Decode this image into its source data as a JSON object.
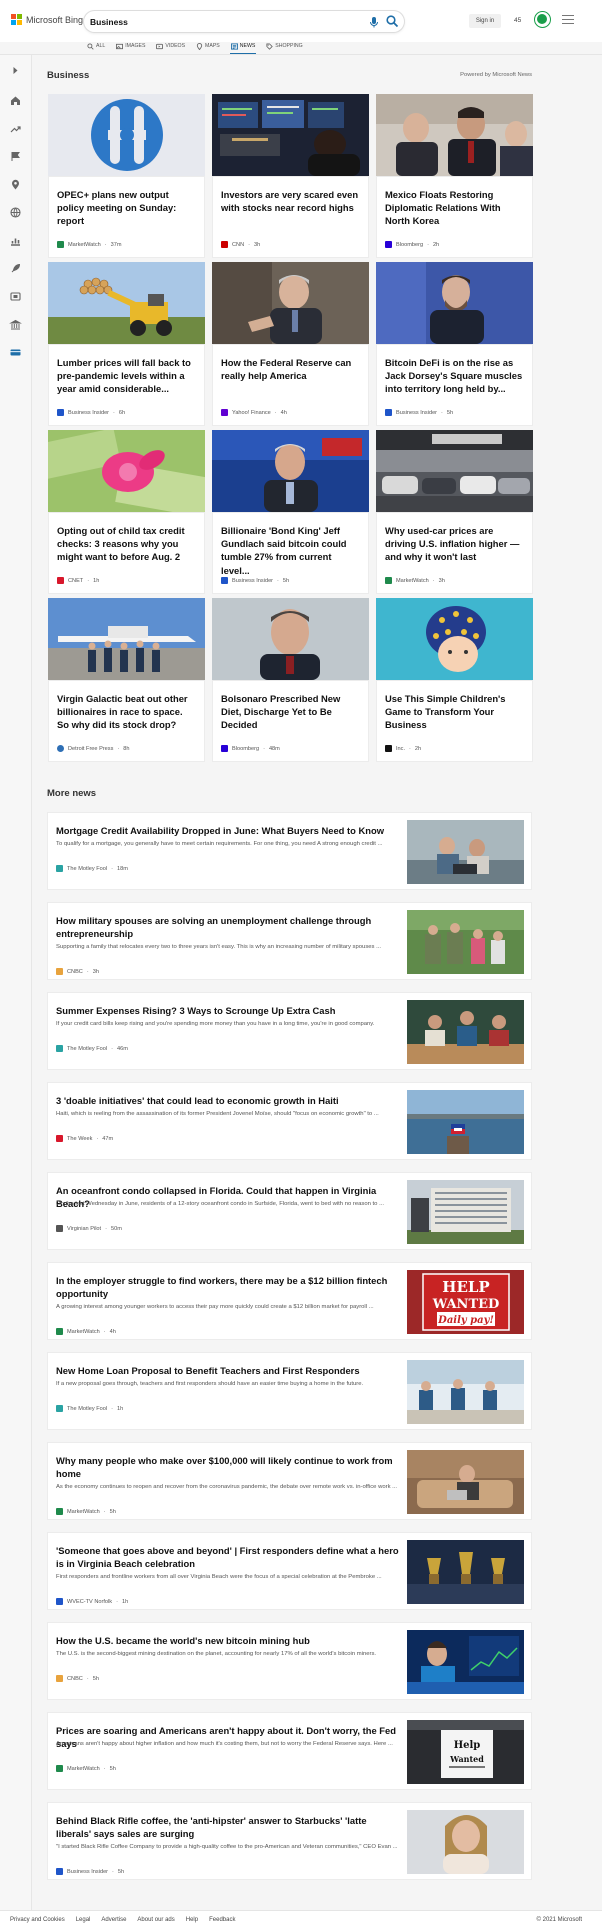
{
  "header": {
    "logo_text": "Microsoft Bing",
    "search_value": "Business",
    "sign_in": "Sign in",
    "points": "45"
  },
  "nav": [
    {
      "label": "ALL",
      "icon": "search-icon"
    },
    {
      "label": "IMAGES",
      "icon": "image-icon"
    },
    {
      "label": "VIDEOS",
      "icon": "video-icon"
    },
    {
      "label": "MAPS",
      "icon": "map-pin-icon"
    },
    {
      "label": "NEWS",
      "icon": "news-icon",
      "active": true
    },
    {
      "label": "SHOPPING",
      "icon": "tag-icon"
    }
  ],
  "section": {
    "title": "Business",
    "powered": "Powered by Microsoft News"
  },
  "top_stories": [
    {
      "title": "OPEC+ plans new output policy meeting on Sunday: report",
      "source": "MarketWatch",
      "time": "37m",
      "brand_color": "#1f8a4c"
    },
    {
      "title": "Investors are very scared even with stocks near record highs",
      "source": "CNN",
      "time": "3h",
      "brand_color": "#cc0000"
    },
    {
      "title": "Mexico Floats Restoring Diplomatic Relations With North Korea",
      "source": "Bloomberg",
      "time": "2h",
      "brand_color": "#2800d7"
    },
    {
      "title": "Lumber prices will fall back to pre-pandemic levels within a year amid considerable...",
      "source": "Business Insider",
      "time": "6h",
      "brand_color": "#1f55c9"
    },
    {
      "title": "How the Federal Reserve can really help America",
      "source": "Yahoo! Finance",
      "time": "4h",
      "brand_color": "#6001d2"
    },
    {
      "title": "Bitcoin DeFi is on the rise as Jack Dorsey's Square muscles into territory long held by...",
      "source": "Business Insider",
      "time": "5h",
      "brand_color": "#1f55c9"
    },
    {
      "title": "Opting out of child tax credit checks: 3 reasons why you might want to before Aug. 2",
      "source": "CNET",
      "time": "1h",
      "brand_color": "#d8172b"
    },
    {
      "title": "Billionaire 'Bond King' Jeff Gundlach said bitcoin could tumble 27% from current level...",
      "source": "Business Insider",
      "time": "5h",
      "brand_color": "#1f55c9"
    },
    {
      "title": "Why used-car prices are driving U.S. inflation higher — and why it won't last",
      "source": "MarketWatch",
      "time": "3h",
      "brand_color": "#1f8a4c"
    },
    {
      "title": "Virgin Galactic beat out other billionaires in race to space. So why did its stock drop?",
      "source": "Detroit Free Press",
      "time": "8h",
      "brand_color": "#2e6fb5"
    },
    {
      "title": "Bolsonaro Prescribed New Diet, Discharge Yet to Be Decided",
      "source": "Bloomberg",
      "time": "48m",
      "brand_color": "#2800d7"
    },
    {
      "title": "Use This Simple Children's Game to Transform Your Business",
      "source": "Inc.",
      "time": "2h",
      "brand_color": "#111111"
    }
  ],
  "more_news_title": "More news",
  "more_news": [
    {
      "title": "Mortgage Credit Availability Dropped in June: What Buyers Need to Know",
      "snippet": "To qualify for a mortgage, you generally have to meet certain requirements. For one thing, you need A strong enough credit ...",
      "source": "The Motley Fool",
      "time": "18m",
      "brand_color": "#2aa3a3"
    },
    {
      "title": "How military spouses are solving an unemployment challenge through entrepreneurship",
      "snippet": "Supporting a family that relocates every two to three years isn't easy. This is why an increasing number of military spouses ...",
      "source": "CNBC",
      "time": "3h",
      "brand_color": "#e8a33d"
    },
    {
      "title": "Summer Expenses Rising? 3 Ways to Scrounge Up Extra Cash",
      "snippet": "If your credit card bills keep rising and you're spending more money than you have in a long time, you're in good company.",
      "source": "The Motley Fool",
      "time": "46m",
      "brand_color": "#2aa3a3"
    },
    {
      "title": "3 'doable initiatives' that could lead to economic growth in Haiti",
      "snippet": "Haiti, which is reeling from the assassination of its former President Jovenel Moïse, should \"focus on economic growth\" to ...",
      "source": "The Week",
      "time": "47m",
      "brand_color": "#d8172b"
    },
    {
      "title": "An oceanfront condo collapsed in Florida. Could that happen in Virginia Beach?",
      "snippet": "On the last Wednesday in June, residents of a 12-story oceanfront condo in Surfside, Florida, went to bed with no reason to ...",
      "source": "Virginian Pilot",
      "time": "50m",
      "brand_color": "#555555"
    },
    {
      "title": "In the employer struggle to find workers, there may be a $12 billion fintech opportunity",
      "snippet": "A growing interest among younger workers to access their pay more quickly could create a $12 billion market for payroll ...",
      "source": "MarketWatch",
      "time": "4h",
      "brand_color": "#1f8a4c"
    },
    {
      "title": "New Home Loan Proposal to Benefit Teachers and First Responders",
      "snippet": "If a new proposal goes through, teachers and first responders should have an easier time buying a home in the future.",
      "source": "The Motley Fool",
      "time": "1h",
      "brand_color": "#2aa3a3"
    },
    {
      "title": "Why many people who make over $100,000 will likely continue to work from home",
      "snippet": "As the economy continues to reopen and recover from the coronavirus pandemic, the debate over remote work vs. in-office work ...",
      "source": "MarketWatch",
      "time": "5h",
      "brand_color": "#1f8a4c"
    },
    {
      "title": "'Someone that goes above and beyond' | First responders define what a hero is in Virginia Beach celebration",
      "snippet": "First responders and frontline workers from all over Virginia Beach were the focus of a special celebration at the Pembroke ...",
      "source": "WVEC-TV Norfolk",
      "time": "1h",
      "brand_color": "#1f55c9"
    },
    {
      "title": "How the U.S. became the world's new bitcoin mining hub",
      "snippet": "The U.S. is the second-biggest mining destination on the planet, accounting for nearly 17% of all the world's bitcoin miners.",
      "source": "CNBC",
      "time": "5h",
      "brand_color": "#e8a33d"
    },
    {
      "title": "Prices are soaring and Americans aren't happy about it. Don't worry, the Fed says",
      "snippet": "Americans aren't happy about higher inflation and how much it's costing them, but not to worry the Federal Reserve says. Here ...",
      "source": "MarketWatch",
      "time": "5h",
      "brand_color": "#1f8a4c"
    },
    {
      "title": "Behind Black Rifle coffee, the 'anti-hipster' answer to Starbucks' 'latte liberals' says sales are surging",
      "snippet": "\"I started Black Rifle Coffee Company to provide a high-quality coffee to the pro-American and Veteran communities,\" CEO Evan ...",
      "source": "Business Insider",
      "time": "5h",
      "brand_color": "#1f55c9"
    }
  ],
  "image_text": {
    "help": "HELP",
    "wanted": "WANTED",
    "daily_pay": "Daily pay!",
    "sign_help": "Help",
    "sign_wanted": "Wanted"
  },
  "footer": {
    "links": [
      "Privacy and Cookies",
      "Legal",
      "Advertise",
      "About our ads",
      "Help",
      "Feedback"
    ],
    "copyright": "© 2021 Microsoft"
  },
  "colors": {
    "accent": "#1e6ea8",
    "reward": "#1a9e4a"
  }
}
